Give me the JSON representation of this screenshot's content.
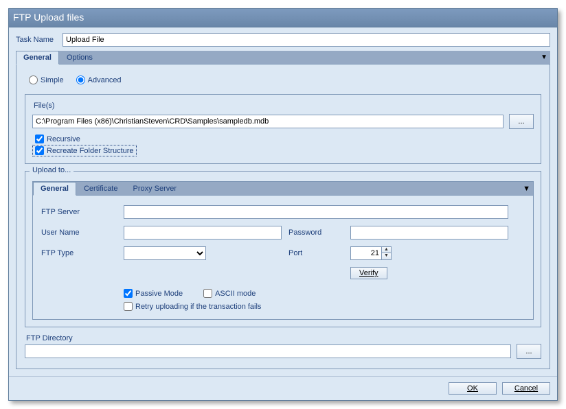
{
  "window": {
    "title": "FTP Upload files"
  },
  "taskName": {
    "label": "Task Name",
    "value": "Upload File"
  },
  "tabs": {
    "general": "General",
    "options": "Options"
  },
  "mode": {
    "simple": "Simple",
    "advanced": "Advanced"
  },
  "files": {
    "label": "File(s)",
    "path": "C:\\Program Files (x86)\\ChristianSteven\\CRD\\Samples\\sampledb.mdb",
    "browse": "...",
    "recursive": "Recursive",
    "recreate": "Recreate Folder Structure"
  },
  "upload": {
    "legend": "Upload to...",
    "tabs": {
      "general": "General",
      "certificate": "Certificate",
      "proxy": "Proxy Server"
    },
    "ftpServer": {
      "label": "FTP Server",
      "value": ""
    },
    "userName": {
      "label": "User Name",
      "value": ""
    },
    "password": {
      "label": "Password",
      "value": ""
    },
    "ftpType": {
      "label": "FTP Type",
      "value": ""
    },
    "port": {
      "label": "Port",
      "value": "21"
    },
    "verify": "Verify",
    "passive": "Passive Mode",
    "ascii": "ASCII mode",
    "retry": "Retry uploading if the transaction fails"
  },
  "ftpDirectory": {
    "label": "FTP Directory",
    "value": "",
    "browse": "..."
  },
  "buttons": {
    "ok": "OK",
    "cancel": "Cancel"
  }
}
